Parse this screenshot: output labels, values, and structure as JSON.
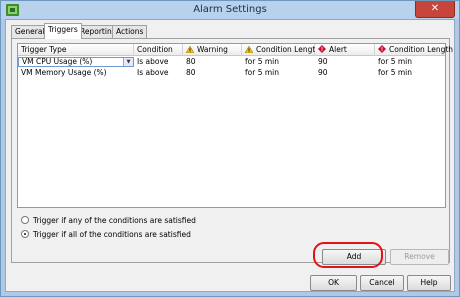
{
  "window": {
    "title": "Alarm Settings",
    "close_glyph": "✕"
  },
  "tabs": [
    {
      "label": "General"
    },
    {
      "label": "Triggers"
    },
    {
      "label": "Reporting"
    },
    {
      "label": "Actions"
    }
  ],
  "table": {
    "headers": {
      "trigger_type": "Trigger Type",
      "condition": "Condition",
      "warning": "Warning",
      "warning_condition_length": "Condition Length",
      "alert": "Alert",
      "alert_condition_length": "Condition Length"
    },
    "rows": [
      {
        "trigger_type": "VM CPU Usage (%)",
        "condition": "Is above",
        "warning": "80",
        "warning_length": "for 5 min",
        "alert": "90",
        "alert_length": "for 5 min"
      },
      {
        "trigger_type": "VM Memory Usage (%)",
        "condition": "Is above",
        "warning": "80",
        "warning_length": "for 5 min",
        "alert": "90",
        "alert_length": "for 5 min"
      }
    ]
  },
  "options": {
    "any": {
      "label": "Trigger if any of the conditions are satisfied",
      "selected": false
    },
    "all": {
      "label": "Trigger if all of the conditions are satisfied",
      "selected": true
    }
  },
  "buttons": {
    "add": "Add",
    "remove": "Remove",
    "ok": "OK",
    "cancel": "Cancel",
    "help": "Help"
  },
  "icons": {
    "warning": "warning-triangle-icon",
    "alert": "alert-diamond-icon",
    "dropdown": "chevron-down-icon"
  },
  "colors": {
    "warning": "#f2c21b",
    "alert": "#c8102e",
    "annotation": "#e0141a"
  }
}
